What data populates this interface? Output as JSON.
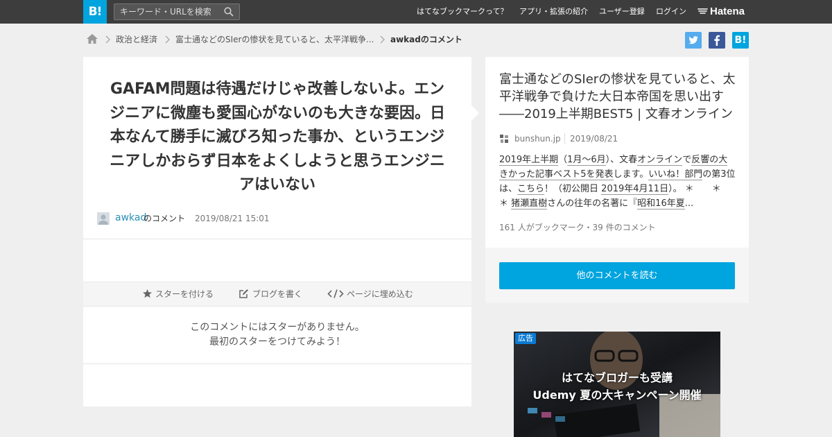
{
  "header": {
    "logo": "B!",
    "search_placeholder": "キーワード・URLを検索",
    "nav": [
      "はてなブックマークって？",
      "アプリ・拡張の紹介",
      "ユーザー登録",
      "ログイン"
    ],
    "hatena_brand": "Hatena"
  },
  "breadcrumb": {
    "items": [
      "政治と経済",
      "富士通などのSIerの惨状を見ていると、太平洋戦争...",
      "awkadのコメント"
    ]
  },
  "share": {
    "hatena_label": "B!"
  },
  "comment": {
    "text": "GAFAM問題は待遇だけじゃ改善しないよ。エンジニアに微塵も愛国心がないのも大きな要因。日本なんて勝手に滅びろ知った事か、というエンジニアしかおらず日本をよくしようと思うエンジニアはいない",
    "username": "awkad",
    "username_suffix": "のコメント",
    "datetime": "2019/08/21 15:01"
  },
  "actions": {
    "star": "スターを付ける",
    "blog": "ブログを書く",
    "embed": "ページに埋め込む"
  },
  "stars": {
    "line1": "このコメントにはスターがありません。",
    "line2": "最初のスターをつけてみよう！"
  },
  "entry": {
    "title": "富士通などのSIerの惨状を見ていると、太平洋戦争で負けた大日本帝国を思い出す――2019上半期BEST5 | 文春オンライン",
    "domain": "bunshun.jp",
    "date": "2019/08/21",
    "summary_segments": [
      {
        "text": "2019年上半期",
        "u": true
      },
      {
        "text": "（",
        "u": false
      },
      {
        "text": "1月～6月",
        "u": true
      },
      {
        "text": "）、文春",
        "u": false
      },
      {
        "text": "オンライン",
        "u": true
      },
      {
        "text": "で",
        "u": false
      },
      {
        "text": "反響の大きかった記事ベスト5を発表",
        "u": true
      },
      {
        "text": "します。",
        "u": false
      },
      {
        "text": "いいね！部門",
        "u": true
      },
      {
        "text": "の第3位は、",
        "u": false
      },
      {
        "text": "こちら",
        "u": true
      },
      {
        "text": "！（初公開日 ",
        "u": false
      },
      {
        "text": "2019年4月11日",
        "u": true
      },
      {
        "text": "）。 ＊　　＊　　＊ ",
        "u": false
      },
      {
        "text": "猪瀬直樹",
        "u": true
      },
      {
        "text": "さんの往年の名著に『",
        "u": false
      },
      {
        "text": "昭和16年夏",
        "u": true
      },
      {
        "text": "...",
        "u": false
      }
    ],
    "counts": "161 人がブックマーク・39 件のコメント",
    "more_button": "他のコメントを読む"
  },
  "ad": {
    "label": "広告",
    "line1": "はてなブロガーも受講",
    "line2": "Udemy 夏の大キャンペーン開催"
  },
  "colors": {
    "accent": "#00a4de",
    "topbar": "#3d3d3d",
    "twitter": "#55acee",
    "facebook": "#3b5998"
  }
}
